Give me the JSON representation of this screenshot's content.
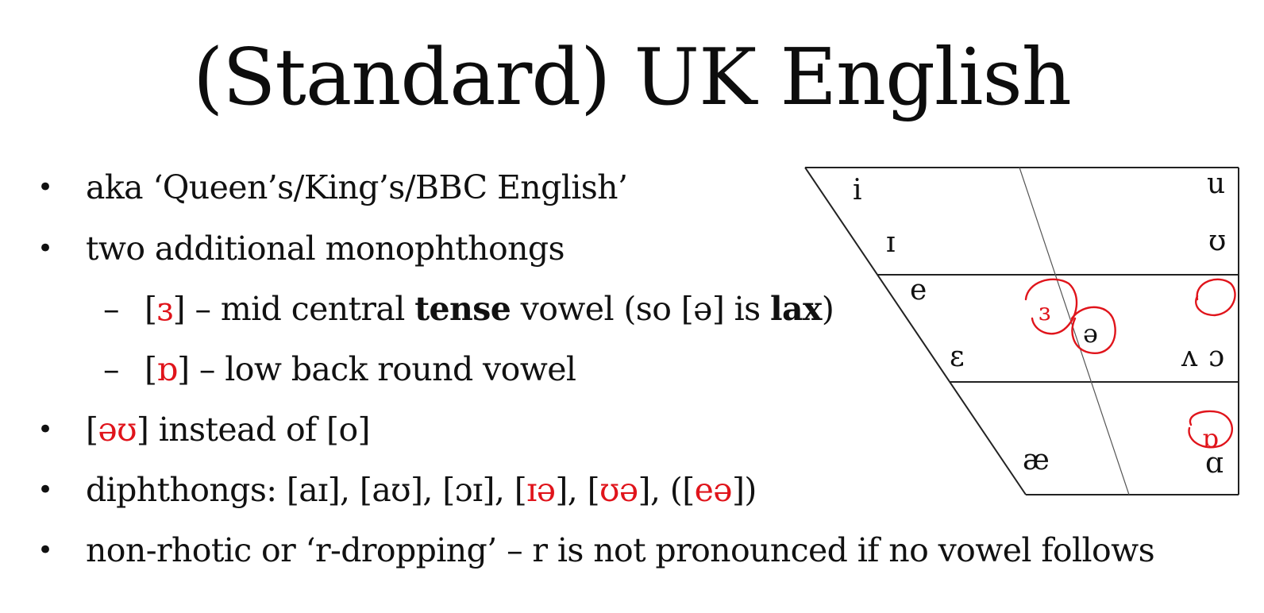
{
  "title": "(Standard) UK English",
  "bullets": {
    "b1": "aka ‘Queen’s/King’s/BBC English’",
    "b2": "two additional monophthongs",
    "s1": {
      "open": "[",
      "sym": "ɜ",
      "mid": "] – mid central ",
      "bold1": "tense",
      "mid2": " vowel (so [ə] is ",
      "bold2": "lax",
      "close": ")"
    },
    "s2": {
      "open": "[",
      "sym": "ɒ",
      "rest": "] – low back round vowel"
    },
    "b3": {
      "open": "[",
      "sym": "əʊ",
      "rest": "] instead of [o]"
    },
    "b4": {
      "lead": "diphthongs: [aɪ], [aʊ], [ɔɪ], [",
      "r1": "ɪə",
      "m1": "], [",
      "r2": "ʊə",
      "m2": "], ([",
      "r3": "eə",
      "end": "])"
    },
    "b5": "non-rhotic or ‘r-dropping’ – r is not pronounced if no vowel follows",
    "bullet_char": "•",
    "dash_char": "–"
  },
  "vowel_chart": {
    "symbols": {
      "i": "i",
      "I": "ɪ",
      "e": "e",
      "eps": "ɛ",
      "ae": "æ",
      "u": "u",
      "upsilon": "ʊ",
      "wedge": "ʌ",
      "openo": "ɔ",
      "alpha": "ɑ",
      "schwa": "ə",
      "rev_eps": "ɜ",
      "turned_alpha": "ɒ"
    },
    "annotation_color": "#e0141b"
  }
}
